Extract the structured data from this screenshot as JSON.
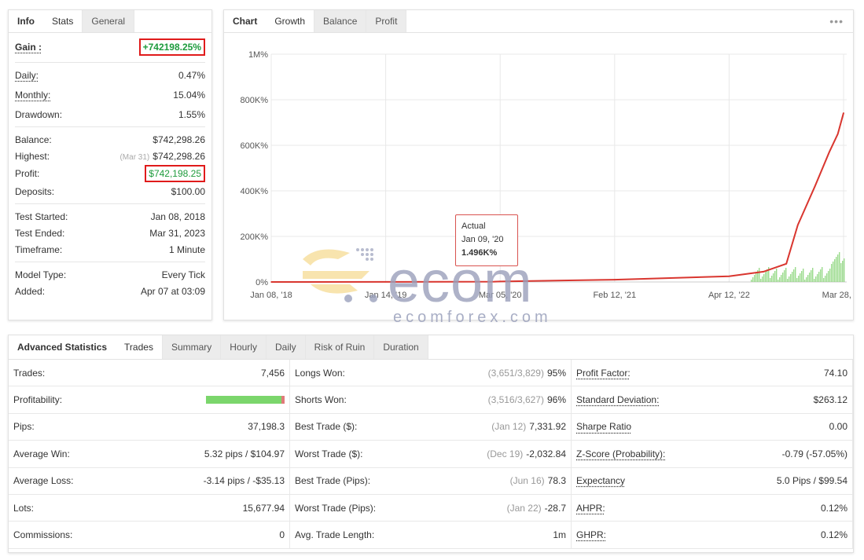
{
  "info_panel": {
    "tabs": [
      {
        "label": "Info"
      },
      {
        "label": "Stats"
      },
      {
        "label": "General"
      }
    ],
    "gain": {
      "label": "Gain :",
      "value": "+742198.25%"
    },
    "daily": {
      "label": "Daily:",
      "value": "0.47%"
    },
    "monthly": {
      "label": "Monthly:",
      "value": "15.04%"
    },
    "drawdown": {
      "label": "Drawdown:",
      "value": "1.55%"
    },
    "balance": {
      "label": "Balance:",
      "value": "$742,298.26"
    },
    "highest": {
      "label": "Highest:",
      "hint": "(Mar 31)",
      "value": "$742,298.26"
    },
    "profit": {
      "label": "Profit:",
      "value": "$742,198.25"
    },
    "deposits": {
      "label": "Deposits:",
      "value": "$100.00"
    },
    "test_started": {
      "label": "Test Started:",
      "value": "Jan 08, 2018"
    },
    "test_ended": {
      "label": "Test Ended:",
      "value": "Mar 31, 2023"
    },
    "timeframe": {
      "label": "Timeframe:",
      "value": "1 Minute"
    },
    "model_type": {
      "label": "Model Type:",
      "value": "Every Tick"
    },
    "added": {
      "label": "Added:",
      "value": "Apr 07 at 03:09"
    }
  },
  "chart_panel": {
    "tabs": [
      {
        "label": "Chart"
      },
      {
        "label": "Growth"
      },
      {
        "label": "Balance"
      },
      {
        "label": "Profit"
      }
    ],
    "menu": "•••",
    "tooltip": {
      "series": "Actual",
      "date": "Jan 09, '20",
      "value": "1.496K%"
    }
  },
  "chart_data": {
    "type": "line",
    "yticks": [
      "1M%",
      "800K%",
      "600K%",
      "400K%",
      "200K%",
      "0%"
    ],
    "xticks": [
      "Jan 08, '18",
      "Jan 14, '19",
      "Mar 05, '20",
      "Feb 12, '21",
      "Apr 12, '22",
      "Mar 28, '23"
    ],
    "ylim": [
      0,
      1000000
    ],
    "series": [
      {
        "color": "#d9362f",
        "x": [
          "Jan 08, '18",
          "Jan 14, '19",
          "Jan 09, '20",
          "Mar 05, '20",
          "Feb 12, '21",
          "Apr 12, '22",
          "Jul '22",
          "Oct '22",
          "Nov '22",
          "Dec '22",
          "Jan '23",
          "Feb '23",
          "Mar 28, '23"
        ],
        "values": [
          0,
          500,
          1496,
          2000,
          10000,
          25000,
          45000,
          80000,
          250000,
          420000,
          570000,
          650000,
          742198
        ]
      }
    ],
    "grid": true,
    "legend": "none"
  },
  "advanced": {
    "tabs": [
      {
        "label": "Advanced Statistics"
      },
      {
        "label": "Trades"
      },
      {
        "label": "Summary"
      },
      {
        "label": "Hourly"
      },
      {
        "label": "Daily"
      },
      {
        "label": "Risk of Ruin"
      },
      {
        "label": "Duration"
      }
    ],
    "col1": [
      {
        "label": "Trades:",
        "value": "7,456"
      },
      {
        "label": "Profitability:",
        "value": ""
      },
      {
        "label": "Pips:",
        "value": "37,198.3"
      },
      {
        "label": "Average Win:",
        "value": "5.32 pips / $104.97"
      },
      {
        "label": "Average Loss:",
        "value": "-3.14 pips / -$35.13"
      },
      {
        "label": "Lots:",
        "value": "15,677.94"
      },
      {
        "label": "Commissions:",
        "value": "0"
      }
    ],
    "profitability_positive_fraction": 0.96,
    "col2": [
      {
        "label": "Longs Won:",
        "hint": "(3,651/3,829)",
        "value": "95%"
      },
      {
        "label": "Shorts Won:",
        "hint": "(3,516/3,627)",
        "value": "96%"
      },
      {
        "label": "Best Trade ($):",
        "hint": "(Jan 12)",
        "value": "7,331.92"
      },
      {
        "label": "Worst Trade ($):",
        "hint": "(Dec 19)",
        "value": "-2,032.84"
      },
      {
        "label": "Best Trade (Pips):",
        "hint": "(Jun 16)",
        "value": "78.3"
      },
      {
        "label": "Worst Trade (Pips):",
        "hint": "(Jan 22)",
        "value": "-28.7"
      },
      {
        "label": "Avg. Trade Length:",
        "hint": "",
        "value": "1m"
      }
    ],
    "col3": [
      {
        "label": "Profit Factor:",
        "value": "74.10"
      },
      {
        "label": "Standard Deviation:",
        "value": "$263.12"
      },
      {
        "label": "Sharpe Ratio",
        "value": "0.00"
      },
      {
        "label": "Z-Score (Probability):",
        "value": "-0.79 (-57.05%)"
      },
      {
        "label": "Expectancy",
        "value": "5.0 Pips / $99.54"
      },
      {
        "label": "AHPR:",
        "value": "0.12%"
      },
      {
        "label": "GHPR:",
        "value": "0.12%"
      }
    ]
  },
  "watermark": {
    "text": "ecomforex.com"
  }
}
